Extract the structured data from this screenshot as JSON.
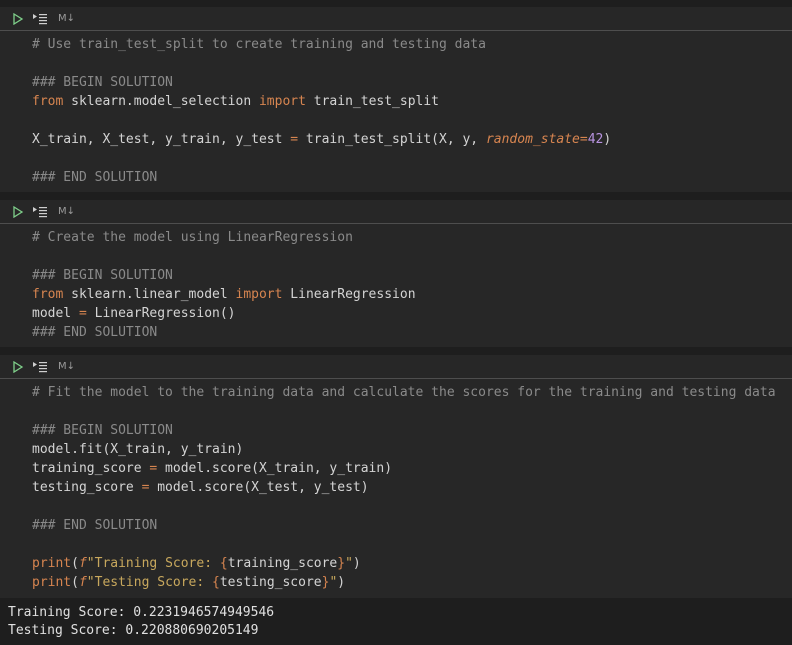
{
  "cells": [
    {
      "badge": "M↓",
      "lines": {
        "l1": "# Use train_test_split to create training and testing data",
        "l2": "### BEGIN SOLUTION",
        "l3_kw_from": "from",
        "l3_mod": " sklearn.model_selection ",
        "l3_kw_import": "import",
        "l3_name": " train_test_split",
        "l4_lhs": "X_train, X_test, y_train, y_test ",
        "l4_eq": "=",
        "l4_call": " train_test_split(X, y, ",
        "l4_param": "random_state",
        "l4_eq2": "=",
        "l4_num": "42",
        "l4_close": ")",
        "l5": "### END SOLUTION"
      }
    },
    {
      "badge": "M↓",
      "lines": {
        "l1": "# Create the model using LinearRegression",
        "l2": "### BEGIN SOLUTION",
        "l3_kw_from": "from",
        "l3_mod": " sklearn.linear_model ",
        "l3_kw_import": "import",
        "l3_name": " LinearRegression",
        "l4_lhs": "model ",
        "l4_eq": "=",
        "l4_rhs": " LinearRegression()",
        "l5": "### END SOLUTION"
      }
    },
    {
      "badge": "M↓",
      "lines": {
        "l1": "# Fit the model to the training data and calculate the scores for the training and testing data",
        "l2": "### BEGIN SOLUTION",
        "l3": "model.fit(X_train, y_train)",
        "l4_lhs": "training_score ",
        "l4_eq": "=",
        "l4_rhs": " model.score(X_train, y_train)",
        "l5_lhs": "testing_score ",
        "l5_eq": "=",
        "l5_rhs": " model.score(X_test, y_test)",
        "l6": "### END SOLUTION",
        "l7_fn": "print",
        "l7_open": "(",
        "l7_f": "f",
        "l7_str": "\"Training Score: ",
        "l7_bo": "{",
        "l7_var": "training_score",
        "l7_bc": "}",
        "l7_end": "\"",
        "l7_close": ")",
        "l8_fn": "print",
        "l8_open": "(",
        "l8_f": "f",
        "l8_str": "\"Testing Score: ",
        "l8_bo": "{",
        "l8_var": "testing_score",
        "l8_bc": "}",
        "l8_end": "\"",
        "l8_close": ")"
      }
    }
  ],
  "output": {
    "line1": "Training Score: 0.2231946574949546",
    "line2": "Testing Score: 0.220880690205149"
  },
  "icons": {
    "run": "play-icon",
    "run_below": "run-below-icon"
  }
}
